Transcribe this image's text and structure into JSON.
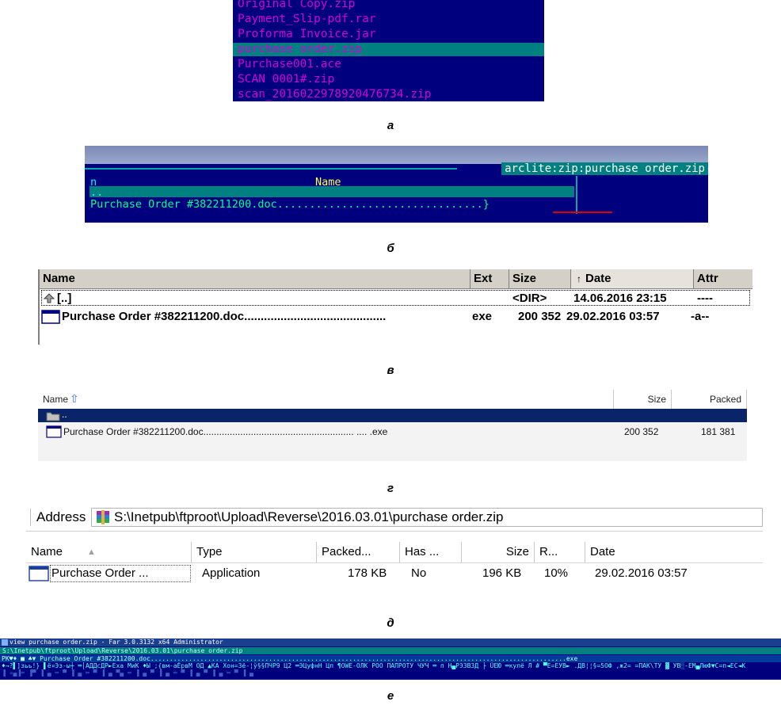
{
  "panel_a": {
    "files": [
      {
        "name": "Original Copy.zip",
        "selected": false
      },
      {
        "name": "Payment_Slip-pdf.rar",
        "selected": false
      },
      {
        "name": "Proforma Invoice.jar",
        "selected": false
      },
      {
        "name": "purchase order.zip",
        "selected": true
      },
      {
        "name": "Purchase001.ace",
        "selected": false
      },
      {
        "name": "SCAN 0001#.zip",
        "selected": false
      },
      {
        "name": "scan_2016022978920476734.zip",
        "selected": false
      }
    ],
    "caption": "а"
  },
  "panel_b": {
    "title": "arclite:zip:purchase order.zip",
    "col_n": "n",
    "col_name": "Name",
    "parent": "..",
    "file": "Purchase Order #382211200.doc................................}",
    "caption": "б"
  },
  "panel_c": {
    "headers": {
      "name": "Name",
      "ext": "Ext",
      "size": "Size",
      "date": "Date",
      "attr": "Attr"
    },
    "parent": {
      "name": "[..]",
      "size": "<DIR>",
      "date": "14.06.2016 23:15",
      "attr": "----"
    },
    "file": {
      "name": "Purchase Order #382211200.doc...........................................",
      "ext": "exe",
      "size": "200 352",
      "date": "29.02.2016 03:57",
      "attr": "-a--"
    },
    "caption": "в"
  },
  "panel_d": {
    "headers": {
      "name": "Name",
      "size": "Size",
      "packed": "Packed"
    },
    "parent": "..",
    "file": {
      "name": "Purchase Order #382211200.doc......................................................... .... .exe",
      "size": "200 352",
      "packed": "181 381"
    },
    "caption": "г"
  },
  "panel_e": {
    "address_label": "Address",
    "address_path": "S:\\Inetpub\\ftproot\\Upload\\Reverse\\2016.03.01\\purchase order.zip",
    "headers": {
      "name": "Name",
      "type": "Type",
      "packed": "Packed...",
      "has": "Has ...",
      "size": "Size",
      "ratio": "R...",
      "date": "Date"
    },
    "row": {
      "name": "Purchase Order ...",
      "type": "Application",
      "packed": "178 KB",
      "has": "No",
      "size": "196 KB",
      "ratio": "10%",
      "date": "29.02.2016 03:57"
    },
    "caption": "д"
  },
  "panel_f": {
    "title": "view purchase order.zip - Far 3.0.3132 x64 Administrator",
    "path": "S:\\Inetpub\\ftproot\\Upload\\Reverse\\2016.03.01\\purchase order.zip",
    "line1": "PK♥♦ ■ ♣▼ Purchase Order #382211200.doc.............................................................................................................exe",
    "line2": "♦→?▌]зьь!} ▌ё¤Эз-ы┼ ═│АДДсДР►Еха МиК ♦Ы ;{вм-аЁрвМ ОД ▲KA Xон=Зё-¦ў§§ПЧР9 Ц2 ═ЭЦуфнН Цп ¶ОWЕ-ОЛК РОО ПАПРОТУ ЧУЧ ═ п Н▄РЭ3ВЗД ├ ÛЕЮ ═кулё Л # ▀Е=ЕУВ► .ДВ¦¦§=5ОФ ,ж2= =ПАК\\ТУ ▓ УВ░-ЕМ▄ЛюФ▼С=п◄ЕС◄К",
    "line3": "▐ ¤▄▐═ ▐▀ ▐ ▄ ═ ▀ ▐ ▄ ═ ▀ ▐ ▄ ▀▄ ═ ▐ ▄ ▀ ▐ ▄ ═ ▀ ▐ ▄ ▀ ▐ ▄ ═ ▀ ▐ ▄",
    "caption": "е"
  }
}
